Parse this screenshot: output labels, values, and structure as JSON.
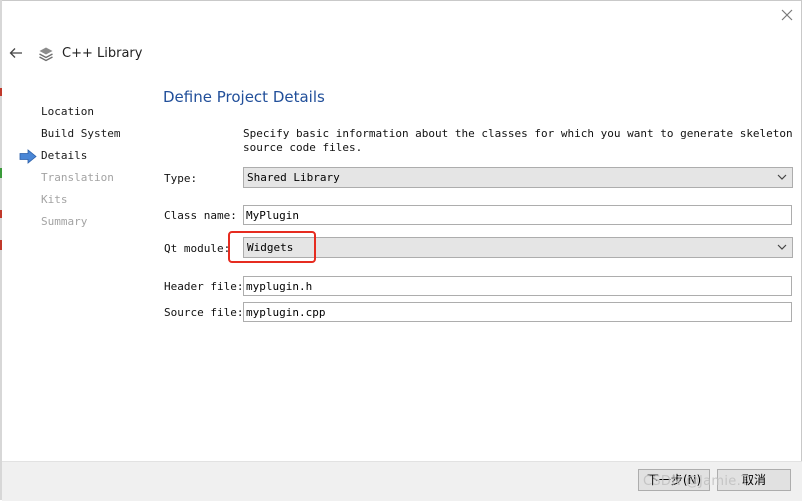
{
  "wizard": {
    "title": "C++ Library",
    "icon": "stack-layers-icon"
  },
  "steps": [
    {
      "label": "Location",
      "state": "done"
    },
    {
      "label": "Build System",
      "state": "done"
    },
    {
      "label": "Details",
      "state": "current"
    },
    {
      "label": "Translation",
      "state": "pending"
    },
    {
      "label": "Kits",
      "state": "pending"
    },
    {
      "label": "Summary",
      "state": "pending"
    }
  ],
  "page": {
    "title": "Define Project Details",
    "description": "Specify basic information about the classes for which you want to generate skeleton source code files."
  },
  "form": {
    "type_label": "Type:",
    "type_value": "Shared Library",
    "class_label": "Class name:",
    "class_value": "MyPlugin",
    "qt_label": "Qt module:",
    "qt_value": "Widgets",
    "header_label": "Header file:",
    "header_value": "myplugin.h",
    "source_label": "Source file:",
    "source_value": "myplugin.cpp"
  },
  "footer": {
    "next_label": "下一步(N)",
    "cancel_label": "取消"
  },
  "watermark": "CSDN @Jamie.T",
  "colors": {
    "title_blue": "#214f9a",
    "highlight_red": "#e62c20",
    "step_arrow": "#4a86d6"
  }
}
